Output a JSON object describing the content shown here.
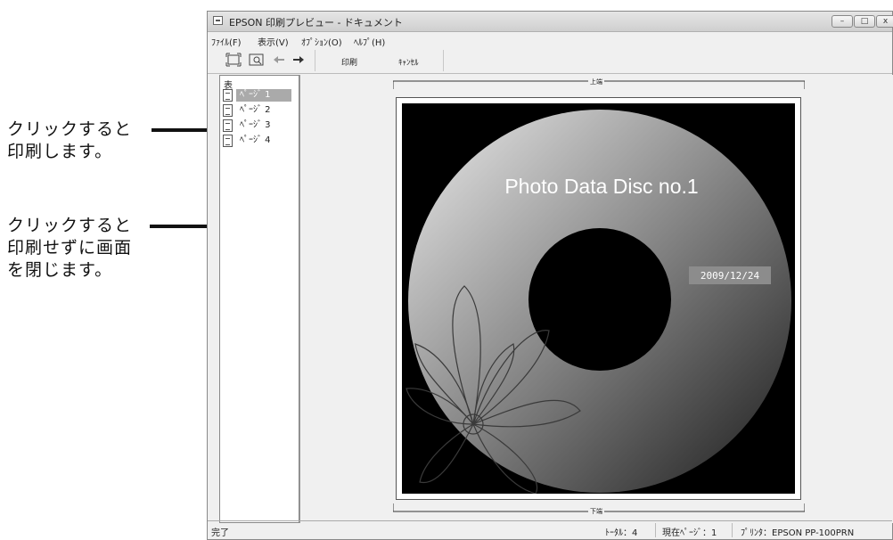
{
  "callouts": {
    "print": [
      "クリックすると",
      "印刷します。"
    ],
    "cancel": [
      "クリックすると",
      "印刷せずに画面",
      "を閉じます。"
    ]
  },
  "window": {
    "title": "EPSON 印刷プレビュー - ドキュメント",
    "controls": {
      "minimize": "–",
      "maximize": "□",
      "close": "x"
    }
  },
  "menu": [
    "ﾌｧｲﾙ(F)",
    "表示(V)",
    "ｵﾌﾟｼｮﾝ(O)",
    "ﾍﾙﾌﾟ(H)"
  ],
  "toolbar": {
    "icons": [
      "fit-page-icon",
      "zoom-icon",
      "prev-page-arrow-icon",
      "next-page-arrow-icon"
    ],
    "print_label": "印刷",
    "cancel_label": "ｷｬﾝｾﾙ"
  },
  "pages_panel": {
    "title": "表",
    "pages": [
      "ﾍﾟｰｼﾞ 1",
      "ﾍﾟｰｼﾞ 2",
      "ﾍﾟｰｼﾞ 3",
      "ﾍﾟｰｼﾞ 4"
    ],
    "selected_index": 0
  },
  "preview": {
    "top_margin_label": "上端",
    "bottom_margin_label": "下端",
    "disc_title": "Photo Data Disc no.1",
    "disc_date": "2009/12/24"
  },
  "status": {
    "ready": "完了",
    "total": "ﾄｰﾀﾙ：4",
    "current_page": "現在ﾍﾟｰｼﾞ：1",
    "printer": "ﾌﾟﾘﾝﾀ：EPSON PP-100PRN"
  },
  "colors": {
    "selection": "#aaaaaa",
    "disc_background": "#000000"
  }
}
